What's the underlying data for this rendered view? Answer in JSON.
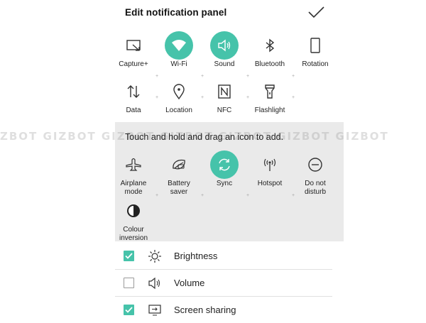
{
  "header": {
    "title": "Edit notification panel"
  },
  "tiles_active": [
    {
      "label": "Capture+",
      "icon": "capture-plus-icon",
      "active": false
    },
    {
      "label": "Wi-Fi",
      "icon": "wifi-icon",
      "active": true
    },
    {
      "label": "Sound",
      "icon": "sound-icon",
      "active": true
    },
    {
      "label": "Bluetooth",
      "icon": "bluetooth-icon",
      "active": false
    },
    {
      "label": "Rotation",
      "icon": "rotation-icon",
      "active": false
    },
    {
      "label": "Data",
      "icon": "data-icon",
      "active": false
    },
    {
      "label": "Location",
      "icon": "location-icon",
      "active": false
    },
    {
      "label": "NFC",
      "icon": "nfc-icon",
      "active": false
    },
    {
      "label": "Flashlight",
      "icon": "flashlight-icon",
      "active": false
    }
  ],
  "tray": {
    "hint": "Touch and hold and drag an icon to add.",
    "tiles": [
      {
        "label": "Airplane mode",
        "icon": "airplane-icon",
        "active": false
      },
      {
        "label": "Battery saver",
        "icon": "battery-saver-icon",
        "active": false
      },
      {
        "label": "Sync",
        "icon": "sync-icon",
        "active": true
      },
      {
        "label": "Hotspot",
        "icon": "hotspot-icon",
        "active": false
      },
      {
        "label": "Do not disturb",
        "icon": "do-not-disturb-icon",
        "active": false
      },
      {
        "label": "Colour inversion",
        "icon": "colour-inversion-icon",
        "active": false
      }
    ]
  },
  "watermark": "ZBOT GIZBOT GIZBOT GIZBOT GIZBOT GIZBOT GIZBOT",
  "rows": [
    {
      "label": "Brightness",
      "checked": true,
      "icon": "brightness-icon"
    },
    {
      "label": "Volume",
      "checked": false,
      "icon": "volume-icon"
    },
    {
      "label": "Screen sharing",
      "checked": true,
      "icon": "screen-sharing-icon"
    }
  ],
  "colors": {
    "accent": "#46c3aa",
    "tray": "#eaeaea"
  }
}
